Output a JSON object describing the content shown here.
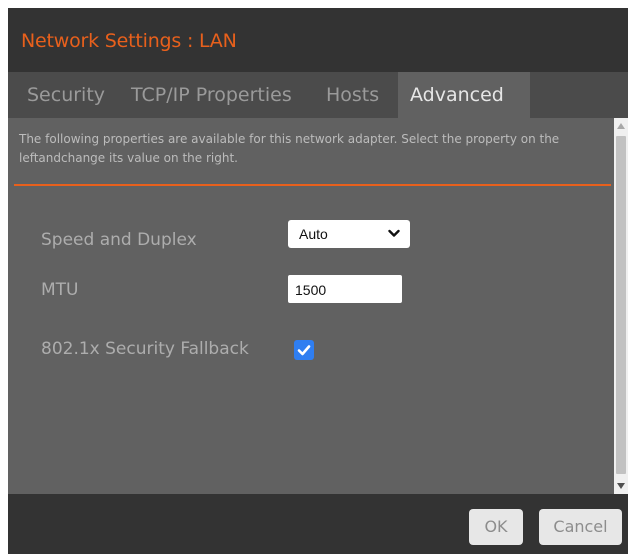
{
  "window": {
    "title": "Network Settings : LAN"
  },
  "tabs": [
    {
      "label": "Security",
      "active": false
    },
    {
      "label": "TCP/IP Properties",
      "active": false
    },
    {
      "label": "Hosts",
      "active": false
    },
    {
      "label": "Advanced",
      "active": true
    }
  ],
  "description": "The following properties are available for this network adapter. Select the property on the leftandchange its value on the right.",
  "fields": {
    "speed_duplex": {
      "label": "Speed and Duplex",
      "value": "Auto",
      "icon": "chevron-down-icon"
    },
    "mtu": {
      "label": "MTU",
      "value": "1500"
    },
    "fallback": {
      "label": "802.1x Security Fallback",
      "checked": true,
      "icon": "checkmark-icon"
    }
  },
  "buttons": {
    "ok": "OK",
    "cancel": "Cancel"
  },
  "colors": {
    "accent": "#e8601c",
    "checkbox": "#2f7ef1",
    "title_bar": "#333333",
    "content_bg": "#616161"
  }
}
